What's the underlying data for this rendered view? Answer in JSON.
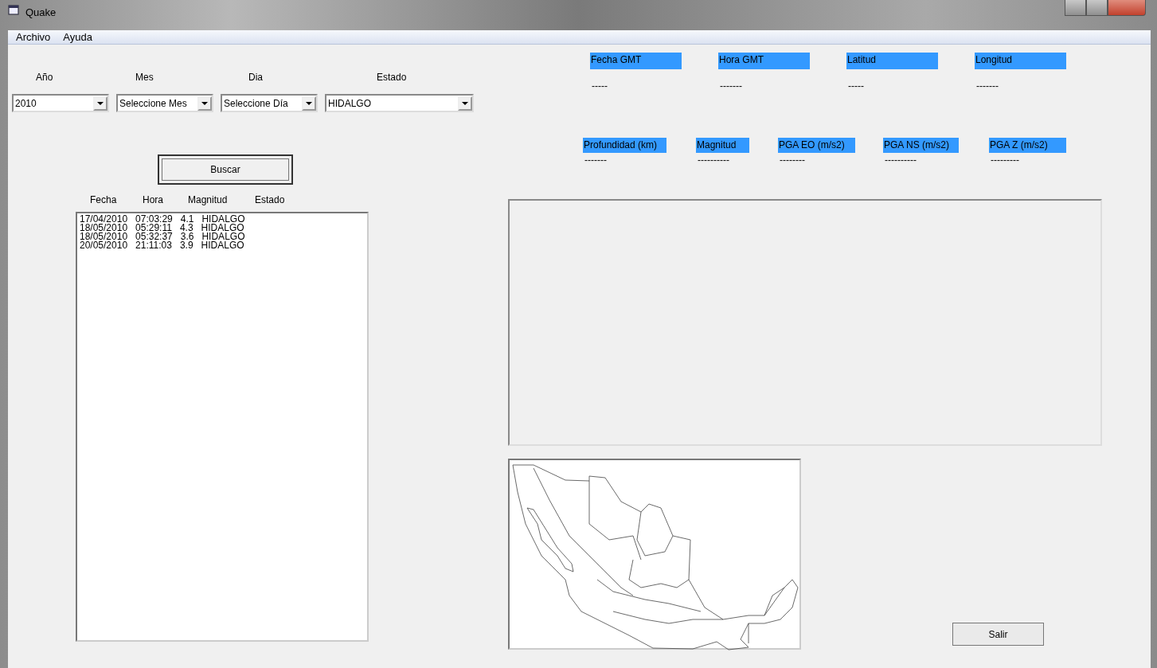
{
  "window": {
    "title": "Quake"
  },
  "menu": [
    {
      "label": "Archivo"
    },
    {
      "label": "Ayuda"
    }
  ],
  "filters": [
    {
      "label": "Año",
      "value": "2010"
    },
    {
      "label": "Mes",
      "value": "Seleccione Mes"
    },
    {
      "label": "Dia",
      "value": "Seleccione Día"
    },
    {
      "label": "Estado",
      "value": "HIDALGO"
    }
  ],
  "search_button": "Buscar",
  "results": {
    "columns": [
      "Fecha",
      "Hora",
      "Magnitud",
      "Estado"
    ],
    "rows": [
      "17/04/2010   07:03:29   4.1   HIDALGO",
      "18/05/2010   05:29:11   4.3   HIDALGO",
      "18/05/2010   05:32:37   3.6   HIDALGO",
      "20/05/2010   21:11:03   3.9   HIDALGO"
    ]
  },
  "details_top": [
    {
      "label": "Fecha GMT",
      "value": "-----"
    },
    {
      "label": "Hora GMT",
      "value": "-------"
    },
    {
      "label": "Latitud",
      "value": "-----"
    },
    {
      "label": "Longitud",
      "value": "-------"
    }
  ],
  "details_bottom": [
    {
      "label": "Profundidad (km)",
      "value": "-------"
    },
    {
      "label": "Magnitud",
      "value": "----------"
    },
    {
      "label": "PGA EO (m/s2)",
      "value": "--------"
    },
    {
      "label": "PGA NS (m/s2)",
      "value": "----------"
    },
    {
      "label": "PGA Z (m/s2)",
      "value": "---------"
    }
  ],
  "exit_button": "Salir"
}
